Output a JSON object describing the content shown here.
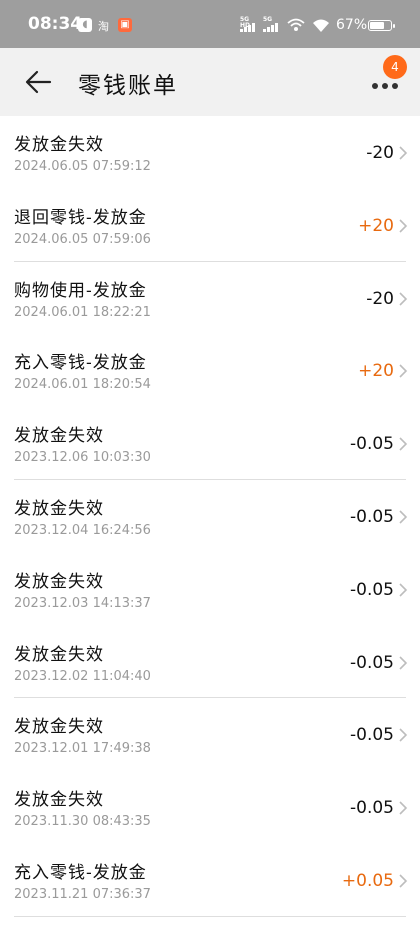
{
  "status_bar": {
    "time": "08:34",
    "taobao_label": "淘",
    "network_1": "5G HD",
    "network_2": "5G",
    "battery_pct": "67%"
  },
  "header": {
    "title": "零钱账单",
    "badge_count": "4"
  },
  "colors": {
    "accent_positive": "#e86a10",
    "badge": "#ff6a1a"
  },
  "bills": [
    {
      "title": "发放金失效",
      "time": "2024.06.05 07:59:12",
      "amount": "-20",
      "positive": false
    },
    {
      "title": "退回零钱-发放金",
      "time": "2024.06.05 07:59:06",
      "amount": "+20",
      "positive": true
    },
    {
      "title": "购物使用-发放金",
      "time": "2024.06.01 18:22:21",
      "amount": "-20",
      "positive": false
    },
    {
      "title": "充入零钱-发放金",
      "time": "2024.06.01 18:20:54",
      "amount": "+20",
      "positive": true
    },
    {
      "title": "发放金失效",
      "time": "2023.12.06 10:03:30",
      "amount": "-0.05",
      "positive": false
    },
    {
      "title": "发放金失效",
      "time": "2023.12.04 16:24:56",
      "amount": "-0.05",
      "positive": false
    },
    {
      "title": "发放金失效",
      "time": "2023.12.03 14:13:37",
      "amount": "-0.05",
      "positive": false
    },
    {
      "title": "发放金失效",
      "time": "2023.12.02 11:04:40",
      "amount": "-0.05",
      "positive": false
    },
    {
      "title": "发放金失效",
      "time": "2023.12.01 17:49:38",
      "amount": "-0.05",
      "positive": false
    },
    {
      "title": "发放金失效",
      "time": "2023.11.30 08:43:35",
      "amount": "-0.05",
      "positive": false
    },
    {
      "title": "充入零钱-发放金",
      "time": "2023.11.21 07:36:37",
      "amount": "+0.05",
      "positive": true
    }
  ]
}
